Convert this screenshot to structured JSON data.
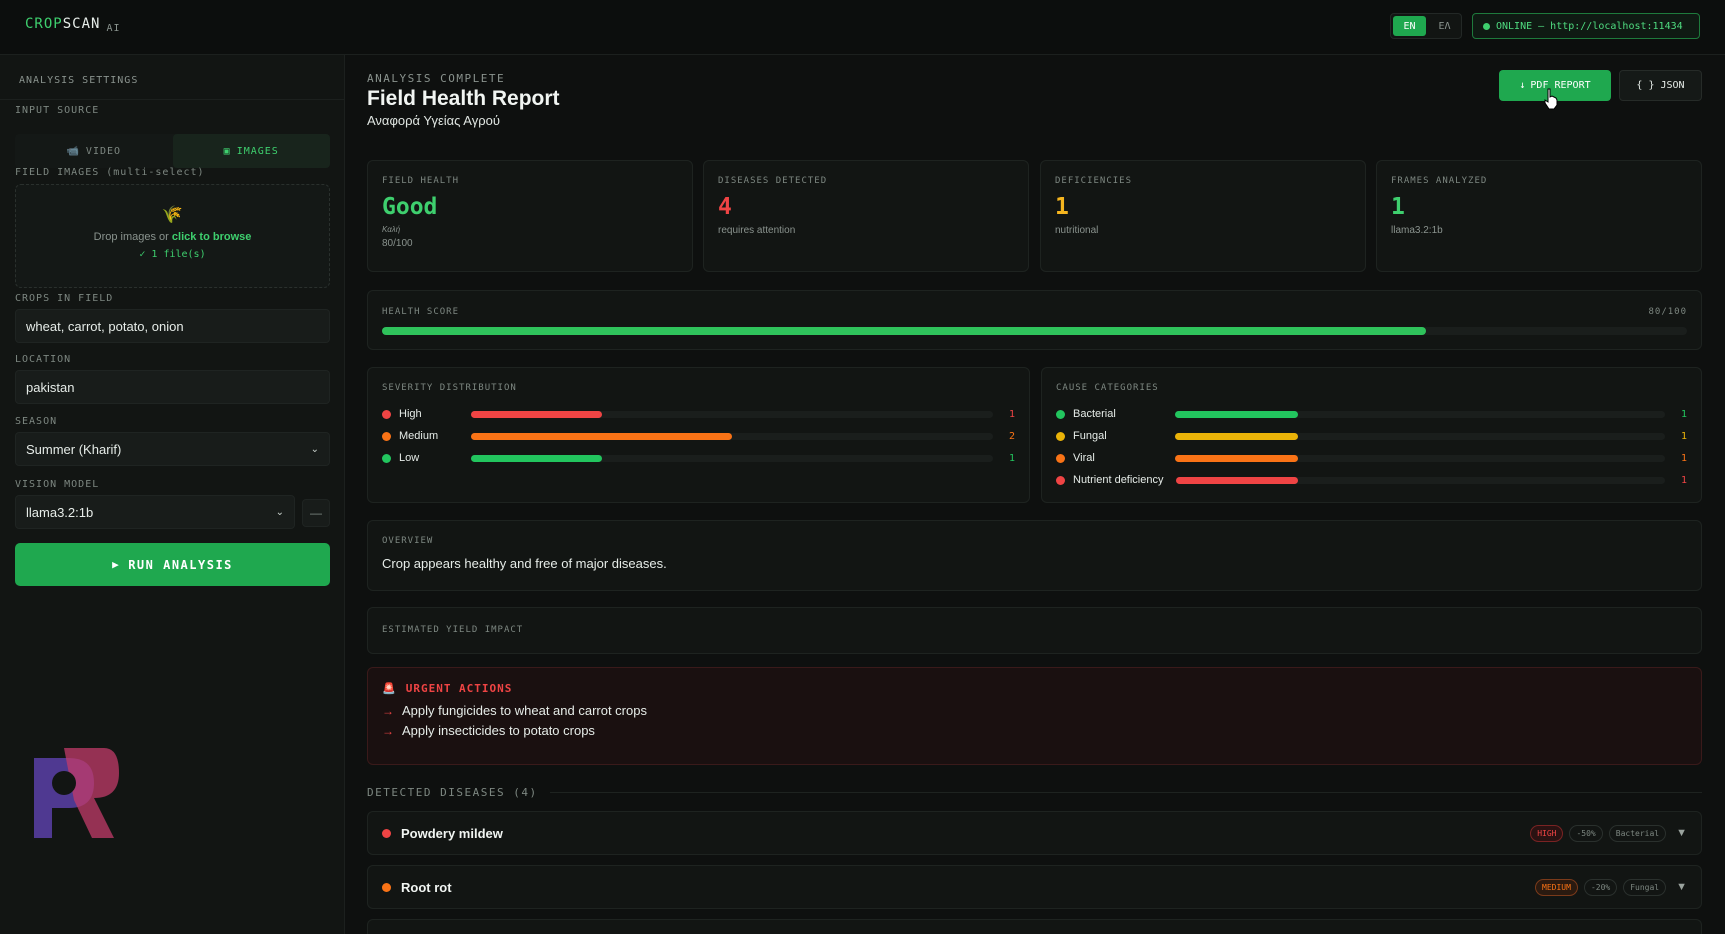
{
  "app": {
    "logo_crop": "CROP",
    "logo_scan": "SCAN",
    "logo_ai": "AI"
  },
  "header": {
    "lang_en": "EN",
    "lang_el": "ΕΛ",
    "status": "ONLINE — http://localhost:11434"
  },
  "sidebar": {
    "heading": "ANALYSIS SETTINGS",
    "input_source_label": "INPUT SOURCE",
    "video_label": "VIDEO",
    "images_label": "IMAGES",
    "field_images_label": "FIELD IMAGES (multi-select)",
    "drop_text": "Drop images or ",
    "drop_link": "click to browse",
    "files_selected": "✓ 1 file(s)",
    "crops_label": "CROPS IN FIELD",
    "crops_value": "wheat, carrot, potato, onion",
    "location_label": "LOCATION",
    "location_value": "pakistan",
    "season_label": "SEASON",
    "season_value": "Summer (Kharif)",
    "model_label": "VISION MODEL",
    "model_value": "llama3.2:1b",
    "model_button": "—",
    "run_label": "RUN ANALYSIS"
  },
  "report": {
    "kicker": "ANALYSIS COMPLETE",
    "title": "Field Health Report",
    "subtitle": "Αναφορά Υγείας Αγρού",
    "pdf_label": "PDF REPORT",
    "json_label": "JSON"
  },
  "stats": [
    {
      "label": "FIELD HEALTH",
      "value": "Good",
      "sub": "Καλή",
      "sub2": "80/100",
      "color": "#3ecf6e"
    },
    {
      "label": "DISEASES DETECTED",
      "value": "4",
      "sub": "requires attention",
      "color": "#ef4444"
    },
    {
      "label": "DEFICIENCIES",
      "value": "1",
      "sub": "nutritional",
      "color": "#f5b51f"
    },
    {
      "label": "FRAMES ANALYZED",
      "value": "1",
      "sub": "llama3.2:1b",
      "color": "#3ecf6e"
    }
  ],
  "health": {
    "label": "HEALTH SCORE",
    "value_text": "80/100",
    "score": 80,
    "max": 100
  },
  "severity": {
    "label": "SEVERITY DISTRIBUTION",
    "max": 4,
    "items": [
      {
        "name": "High",
        "count": 1,
        "color": "#ef4444"
      },
      {
        "name": "Medium",
        "count": 2,
        "color": "#f97316"
      },
      {
        "name": "Low",
        "count": 1,
        "color": "#22c55e"
      }
    ]
  },
  "causes": {
    "label": "CAUSE CATEGORIES",
    "max": 4,
    "items": [
      {
        "name": "Bacterial",
        "count": 1,
        "color": "#22c55e"
      },
      {
        "name": "Fungal",
        "count": 1,
        "color": "#eab308"
      },
      {
        "name": "Viral",
        "count": 1,
        "color": "#f97316"
      },
      {
        "name": "Nutrient deficiency",
        "count": 1,
        "color": "#ef4444"
      }
    ]
  },
  "overview": {
    "label": "OVERVIEW",
    "text": "Crop appears healthy and free of major diseases."
  },
  "yield": {
    "label": "ESTIMATED YIELD IMPACT"
  },
  "urgent": {
    "label": "URGENT ACTIONS",
    "items": [
      "Apply fungicides to wheat and carrot crops",
      "Apply insecticides to potato crops"
    ]
  },
  "detected": {
    "label": "DETECTED DISEASES (4)",
    "items": [
      {
        "name": "Powdery mildew",
        "severity": "HIGH",
        "impact": "-50%",
        "category": "Bacterial",
        "color": "#ef4444"
      },
      {
        "name": "Root rot",
        "severity": "MEDIUM",
        "impact": "-20%",
        "category": "Fungal",
        "color": "#f97316"
      }
    ]
  }
}
